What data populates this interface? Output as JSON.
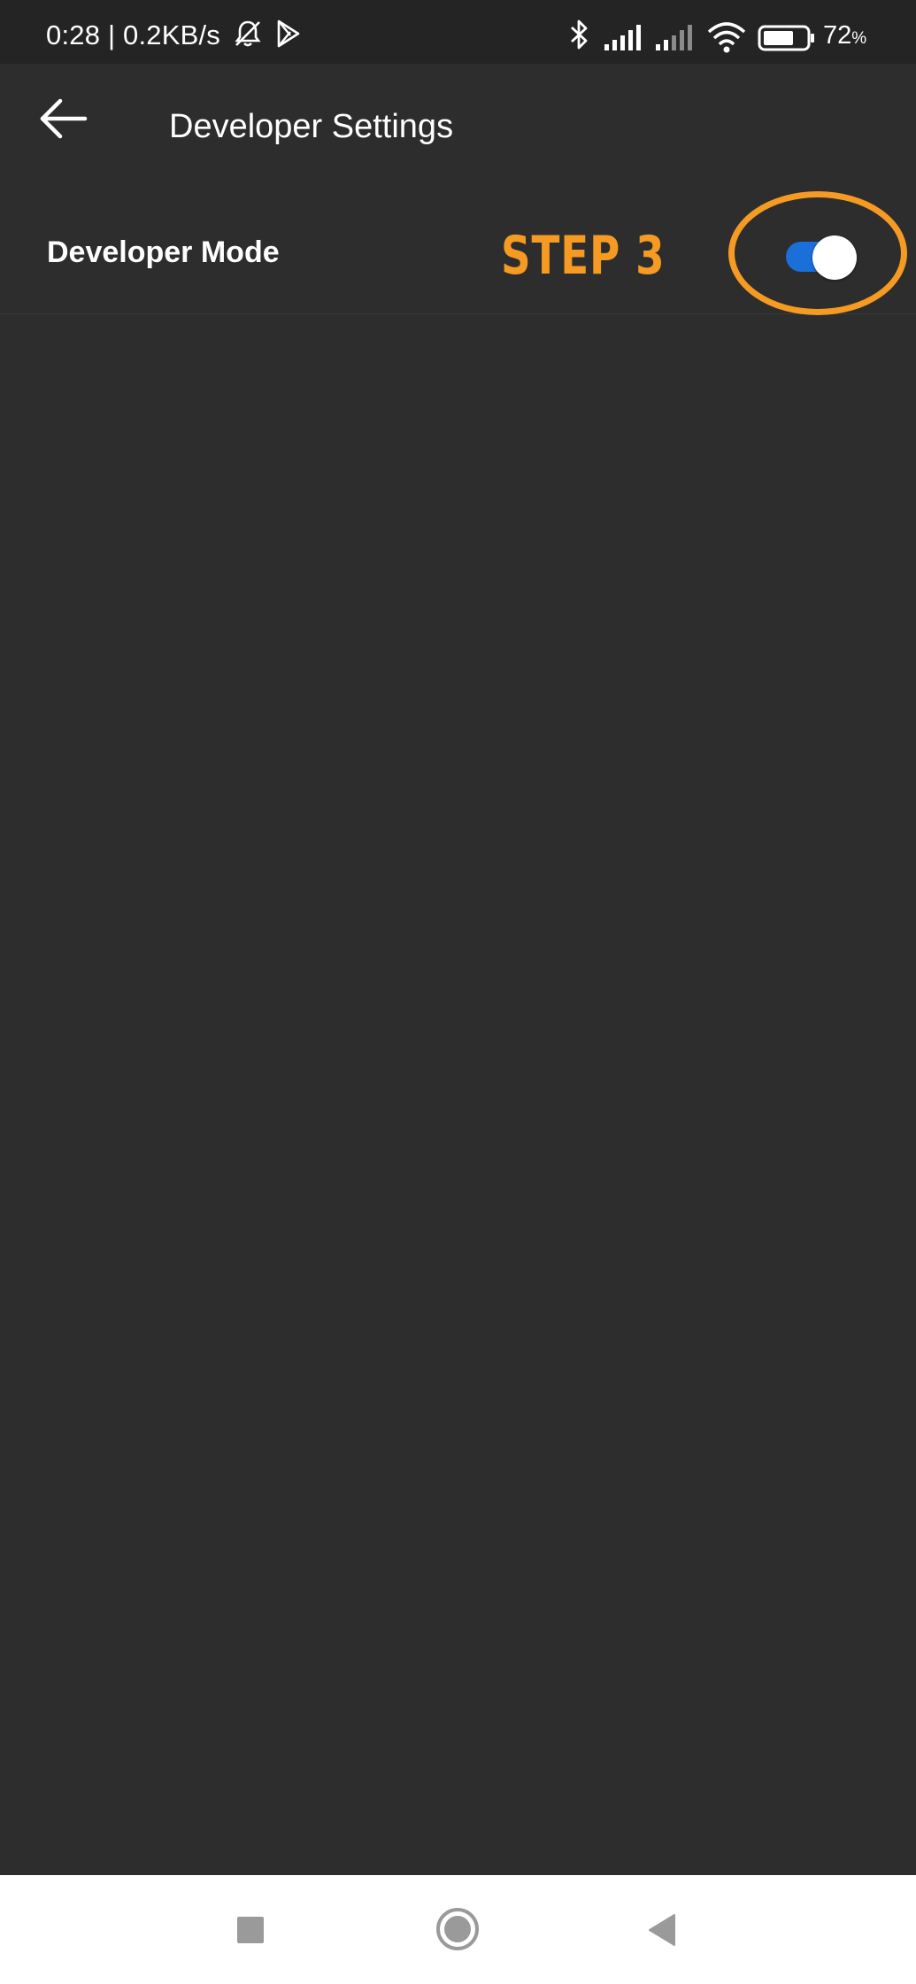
{
  "status_bar": {
    "time_speed": "0:28 | 0.2KB/s",
    "battery_percent": "72",
    "battery_suffix": "%",
    "icons": [
      "bell-off-icon",
      "play-store-icon",
      "bluetooth-icon",
      "signal-icon",
      "signal-icon",
      "wifi-icon",
      "battery-icon"
    ],
    "battery_level": 0.72
  },
  "header": {
    "back_icon": "arrow-left-icon",
    "title": "Developer Settings"
  },
  "settings": {
    "developer_mode": {
      "label": "Developer Mode",
      "enabled": true
    }
  },
  "annotation": {
    "text": "STEP 3",
    "color": "#f59a22"
  },
  "nav_bar": {
    "buttons": [
      "recents-square-icon",
      "home-circle-icon",
      "back-triangle-icon"
    ]
  },
  "colors": {
    "background": "#2d2d2d",
    "status_bar": "#242424",
    "toggle_on": "#1a6fd9",
    "accent_annotation": "#f59a22"
  }
}
